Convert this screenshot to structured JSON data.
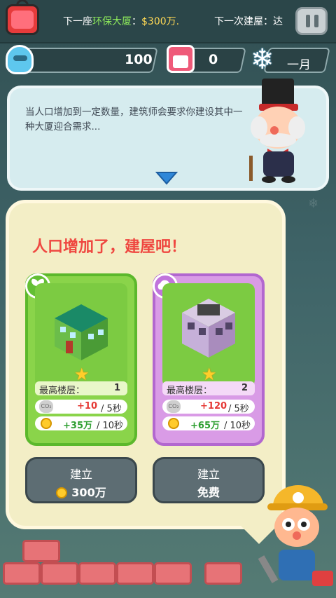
{
  "top": {
    "next_building_prefix": "下一座",
    "next_building_name": "环保大厦",
    "colon": "：",
    "next_building_cost": "$300万.",
    "next_construction": "下一次建屋：达"
  },
  "stats": {
    "population": "100",
    "days": "0",
    "month": "一月"
  },
  "speech": {
    "text": "当人口增加到一定数量，建筑师会要求你建设其中一种大厦迎合需求..."
  },
  "panel": {
    "headline": "人口增加了，建屋吧！"
  },
  "cards": [
    {
      "floor_label": "最高楼层：",
      "floor_value": "1",
      "co2_value": "+10",
      "co2_rate": "/ 5秒",
      "money_value": "+35万",
      "money_rate": "/ 10秒",
      "button_label": "建立",
      "button_cost": "300万"
    },
    {
      "floor_label": "最高楼层：",
      "floor_value": "2",
      "co2_value": "+120",
      "co2_rate": "/ 5秒",
      "money_value": "+65万",
      "money_rate": "/ 10秒",
      "button_label": "建立",
      "button_cost": "免费"
    }
  ],
  "icons": {
    "tv": "tv-icon",
    "pause": "pause-icon",
    "population": "population-icon",
    "calendar": "calendar-icon",
    "snowflake": "snowflake-icon",
    "eco": "leaf-icon",
    "cloud": "cloud-icon",
    "co2": "co2-icon",
    "coin": "coin-icon",
    "star": "star-icon"
  },
  "colors": {
    "accent_red": "#ef4740",
    "eco_green": "#8ad44a",
    "cloud_purple": "#d99be6",
    "money_green": "#2f9f32",
    "co2_red": "#e53935"
  }
}
